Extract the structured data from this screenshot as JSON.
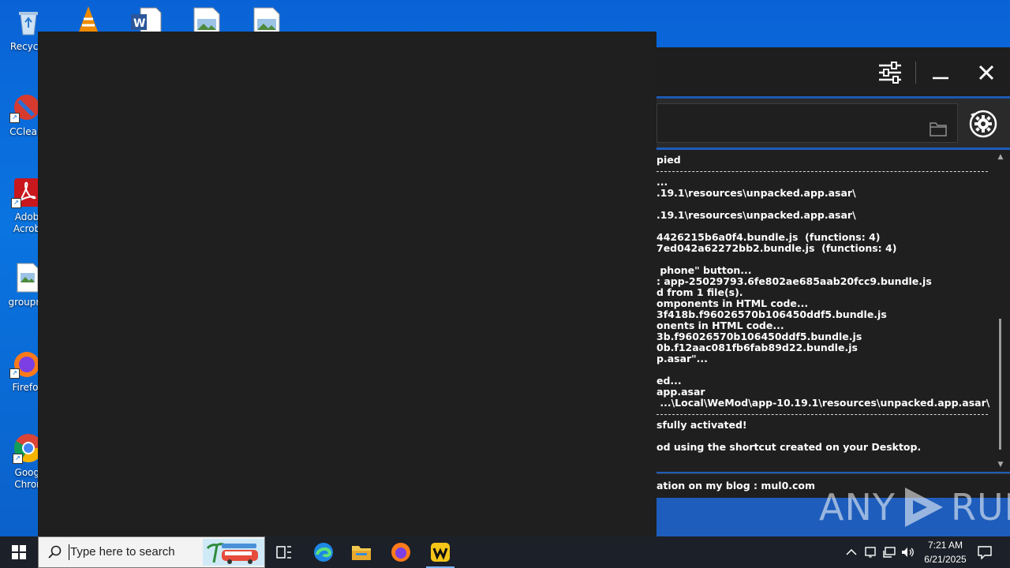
{
  "desktop": {
    "icons": [
      {
        "label": "Recycle",
        "icon": "recycle-bin-icon"
      },
      {
        "label": "CClear",
        "icon": "ccleaner-icon"
      },
      {
        "label": "Adob Acrob",
        "icon": "adobe-acrobat-icon"
      },
      {
        "label": "groupre",
        "icon": "image-file-icon"
      },
      {
        "label": "Firefo",
        "icon": "firefox-icon"
      },
      {
        "label": "Googl Chron",
        "icon": "chrome-icon"
      }
    ],
    "top_icons": [
      "vlc-icon",
      "word-document-icon",
      "image-file-icon",
      "image-file-icon"
    ]
  },
  "tool": {
    "log_lines": [
      {
        "kind": "text",
        "text": "pied"
      },
      {
        "kind": "rule",
        "text": ""
      },
      {
        "kind": "text",
        "text": "..."
      },
      {
        "kind": "text",
        "text": ".19.1\\resources\\unpacked.app.asar\\"
      },
      {
        "kind": "text",
        "text": ""
      },
      {
        "kind": "text",
        "text": ".19.1\\resources\\unpacked.app.asar\\"
      },
      {
        "kind": "text",
        "text": ""
      },
      {
        "kind": "text",
        "text": "4426215b6a0f4.bundle.js  (functions: 4)"
      },
      {
        "kind": "text",
        "text": "7ed042a62272bb2.bundle.js  (functions: 4)"
      },
      {
        "kind": "text",
        "text": ""
      },
      {
        "kind": "text",
        "text": " phone\" button..."
      },
      {
        "kind": "text",
        "text": ": app-25029793.6fe802ae685aab20fcc9.bundle.js"
      },
      {
        "kind": "text",
        "text": "d from 1 file(s)."
      },
      {
        "kind": "text",
        "text": "omponents in HTML code..."
      },
      {
        "kind": "text",
        "text": "3f418b.f96026570b106450ddf5.bundle.js"
      },
      {
        "kind": "text",
        "text": "onents in HTML code..."
      },
      {
        "kind": "text",
        "text": "3b.f96026570b106450ddf5.bundle.js"
      },
      {
        "kind": "text",
        "text": "0b.f12aac081fb6fab89d22.bundle.js"
      },
      {
        "kind": "text",
        "text": "p.asar\"..."
      },
      {
        "kind": "text",
        "text": ""
      },
      {
        "kind": "text",
        "text": "ed..."
      },
      {
        "kind": "text",
        "text": "app.asar"
      },
      {
        "kind": "text",
        "text": " ...\\Local\\WeMod\\app-10.19.1\\resources\\unpacked.app.asar\\"
      },
      {
        "kind": "rule",
        "text": ""
      },
      {
        "kind": "text",
        "text": "sfully activated!"
      },
      {
        "kind": "text",
        "text": ""
      },
      {
        "kind": "text",
        "text": "od using the shortcut created on your Desktop."
      }
    ],
    "status_text": "ation on my blog : mul0.com"
  },
  "watermark": {
    "left": "ANY",
    "right": "RUN"
  },
  "taskbar": {
    "search_placeholder": "Type here to search",
    "apps": [
      "task-view-icon",
      "edge-icon",
      "file-explorer-icon",
      "firefox-icon",
      "wemod-icon"
    ],
    "time": "7:21 AM",
    "date": "6/21/2025"
  },
  "colors": {
    "desktop": "#0a63d6",
    "window_dark": "#1f1f1f",
    "taskbar": "#1c2028"
  }
}
